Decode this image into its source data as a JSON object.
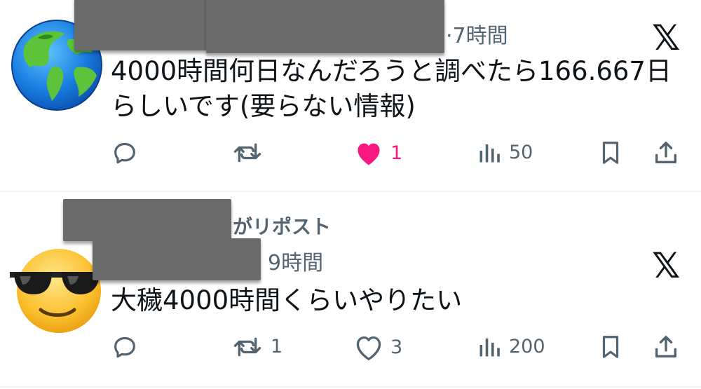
{
  "tweets": [
    {
      "time": "·7時間",
      "text": "4000時間何日なんだろうと調べたら166.667日らしいです(要らない情報)",
      "reply_count": "",
      "repost_count": "",
      "like_count": "1",
      "view_count": "50",
      "liked": true,
      "avatar_icon": "earth-globe-emoji"
    },
    {
      "repost_label": "がリポスト",
      "time": "9時間",
      "text": "大穢4000時間くらいやりたい",
      "reply_count": "",
      "repost_count": "1",
      "like_count": "3",
      "view_count": "200",
      "liked": false,
      "avatar_icon": "smiling-face-with-sunglasses-emoji"
    }
  ],
  "icons": {
    "reply": "reply-icon",
    "repost": "repost-icon",
    "like": "heart-icon",
    "views": "views-chart-icon",
    "bookmark": "bookmark-icon",
    "share": "share-icon",
    "platform": "x-logo-icon"
  },
  "colors": {
    "text": "#0f1419",
    "muted": "#536471",
    "like_active": "#f91880",
    "redaction": "#6b6b6b",
    "divider": "#eff3f4"
  }
}
